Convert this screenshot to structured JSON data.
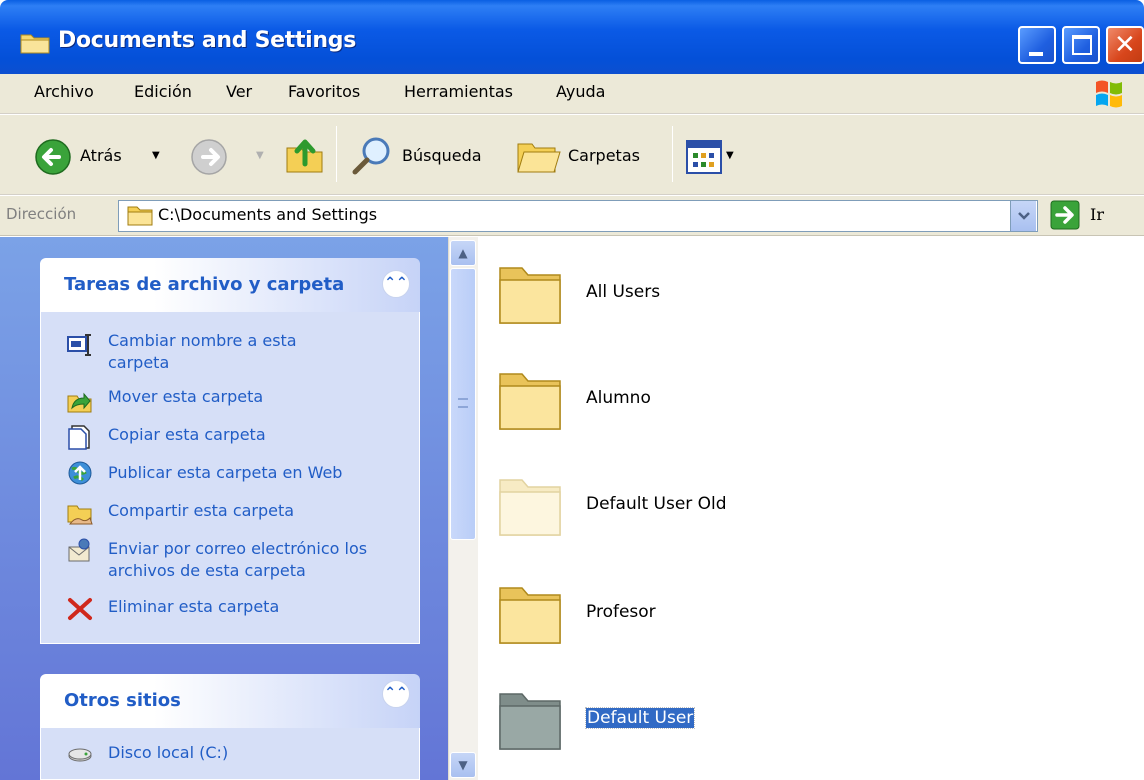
{
  "window": {
    "title": "Documents and Settings"
  },
  "menu": [
    "Archivo",
    "Edición",
    "Ver",
    "Favoritos",
    "Herramientas",
    "Ayuda"
  ],
  "toolbar": {
    "back_label": "Atrás",
    "search_label": "Búsqueda",
    "folders_label": "Carpetas"
  },
  "address": {
    "label": "Dirección",
    "path": "C:\\Documents and Settings",
    "go_label": "Ir"
  },
  "tasks_panel": {
    "title": "Tareas de archivo y carpeta",
    "items": [
      {
        "label": "Cambiar nombre a esta carpeta",
        "icon": "rename-icon"
      },
      {
        "label": "Mover esta carpeta",
        "icon": "move-icon"
      },
      {
        "label": "Copiar esta carpeta",
        "icon": "copy-icon"
      },
      {
        "label": "Publicar esta carpeta en Web",
        "icon": "publish-web-icon"
      },
      {
        "label": "Compartir esta carpeta",
        "icon": "share-icon"
      },
      {
        "label": "Enviar por correo electrónico los archivos de esta carpeta",
        "icon": "email-icon"
      },
      {
        "label": "Eliminar esta carpeta",
        "icon": "delete-icon"
      }
    ]
  },
  "other_places": {
    "title": "Otros sitios",
    "items": [
      {
        "label": "Disco local (C:)",
        "icon": "local-disk-icon"
      }
    ]
  },
  "folders": [
    {
      "name": "All Users",
      "state": "normal"
    },
    {
      "name": "Alumno",
      "state": "normal"
    },
    {
      "name": "Default User Old",
      "state": "hidden"
    },
    {
      "name": "Profesor",
      "state": "normal"
    },
    {
      "name": "Default User",
      "state": "selected"
    }
  ],
  "colors": {
    "titlebar": "#0a5fe3",
    "task_link": "#215dc6",
    "selection": "#316ac5",
    "taskpane": "#6f8fe0"
  }
}
